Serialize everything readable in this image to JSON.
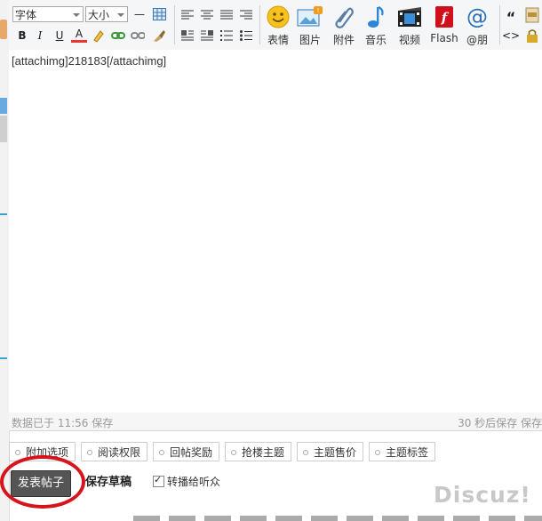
{
  "toolbar": {
    "font_select": "字体",
    "size_select": "大小",
    "buttons_row2": {
      "bold": "B",
      "italic": "I",
      "underline": "U",
      "color": "A"
    },
    "insert": [
      {
        "label": "表情",
        "icon": "smiley-icon"
      },
      {
        "label": "图片",
        "icon": "image-icon"
      },
      {
        "label": "附件",
        "icon": "paperclip-icon"
      },
      {
        "label": "音乐",
        "icon": "music-note-icon"
      },
      {
        "label": "视频",
        "icon": "film-icon"
      },
      {
        "label": "Flash",
        "icon": "flash-icon"
      },
      {
        "label": "@朋",
        "icon": "at-icon"
      }
    ],
    "quote_glyph": "“",
    "code_glyph": "<>"
  },
  "editor": {
    "content": "[attachimg]218183[/attachimg]"
  },
  "status": {
    "left": "数据已于 11:56 保存",
    "right": "30 秒后保存 保存"
  },
  "options": [
    "附加选项",
    "阅读权限",
    "回帖奖励",
    "抢楼主题",
    "主题售价",
    "主题标签"
  ],
  "actions": {
    "post": "发表帖子",
    "draft": "保存草稿",
    "broadcast": "转播给听众"
  },
  "brand": "Discuz!",
  "colors": {
    "highlight_ring": "#d7141b",
    "post_button": "#555555"
  }
}
